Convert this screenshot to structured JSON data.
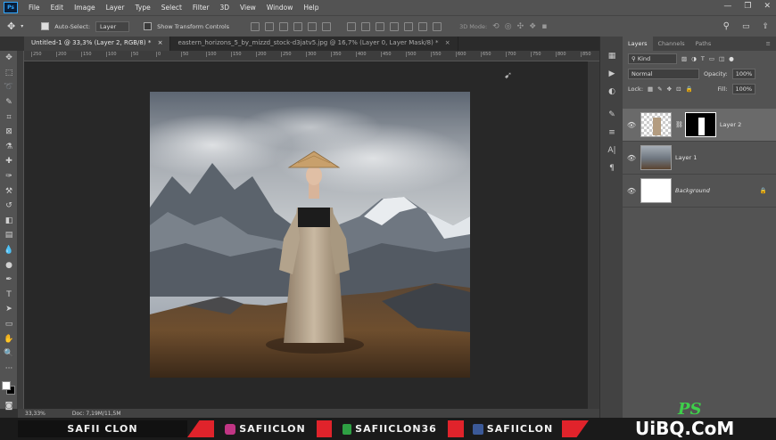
{
  "app": {
    "logo": "Ps"
  },
  "menu": [
    "File",
    "Edit",
    "Image",
    "Layer",
    "Type",
    "Select",
    "Filter",
    "3D",
    "View",
    "Window",
    "Help"
  ],
  "window_controls": [
    "—",
    "❐",
    "✕"
  ],
  "options_bar": {
    "auto_select_label": "Auto-Select:",
    "auto_select_value": "Layer",
    "show_transform_label": "Show Transform Controls",
    "mode_label": "3D Mode:"
  },
  "tabs": [
    {
      "label": "Untitled-1 @ 33,3% (Layer 2, RGB/8) *",
      "close": "×"
    },
    {
      "label": "eastern_horizons_5_by_mizzd_stock-d3jatv5.jpg @ 16,7% (Layer 0, Layer Mask/8) *",
      "close": "×"
    }
  ],
  "ruler_ticks": [
    "250",
    "200",
    "150",
    "100",
    "50",
    "0",
    "50",
    "100",
    "150",
    "200",
    "250",
    "300",
    "350",
    "400",
    "450",
    "500",
    "550",
    "600",
    "650",
    "700",
    "750",
    "800",
    "850"
  ],
  "status": {
    "zoom": "33,33%",
    "doc": "Doc: 7,19M/11,5M"
  },
  "panel": {
    "tabs": [
      "Layers",
      "Channels",
      "Paths"
    ],
    "kind_label": "Kind",
    "blend_mode": "Normal",
    "opacity_label": "Opacity:",
    "opacity_value": "100%",
    "lock_label": "Lock:",
    "fill_label": "Fill:",
    "fill_value": "100%",
    "layers": [
      {
        "name": "Layer 2",
        "selected": true
      },
      {
        "name": "Layer 1",
        "selected": false
      },
      {
        "name": "Background",
        "selected": false
      }
    ]
  },
  "bottom_bar": {
    "channel_name": "SAFII CLON",
    "instagram": "SAFIICLON",
    "mobile": "SAFIICLON36",
    "facebook": "SAFIICLON",
    "watermark_ps": "PS",
    "watermark_site": "UiBQ.CoM"
  },
  "icons": {
    "menu_search": "search-icon",
    "workspace": "workspace-icon",
    "share": "share-icon"
  },
  "colors": {
    "banner_red": "#e0232b",
    "instagram": "#c13584",
    "facebook": "#3b5998",
    "mobile": "#2ea043"
  }
}
